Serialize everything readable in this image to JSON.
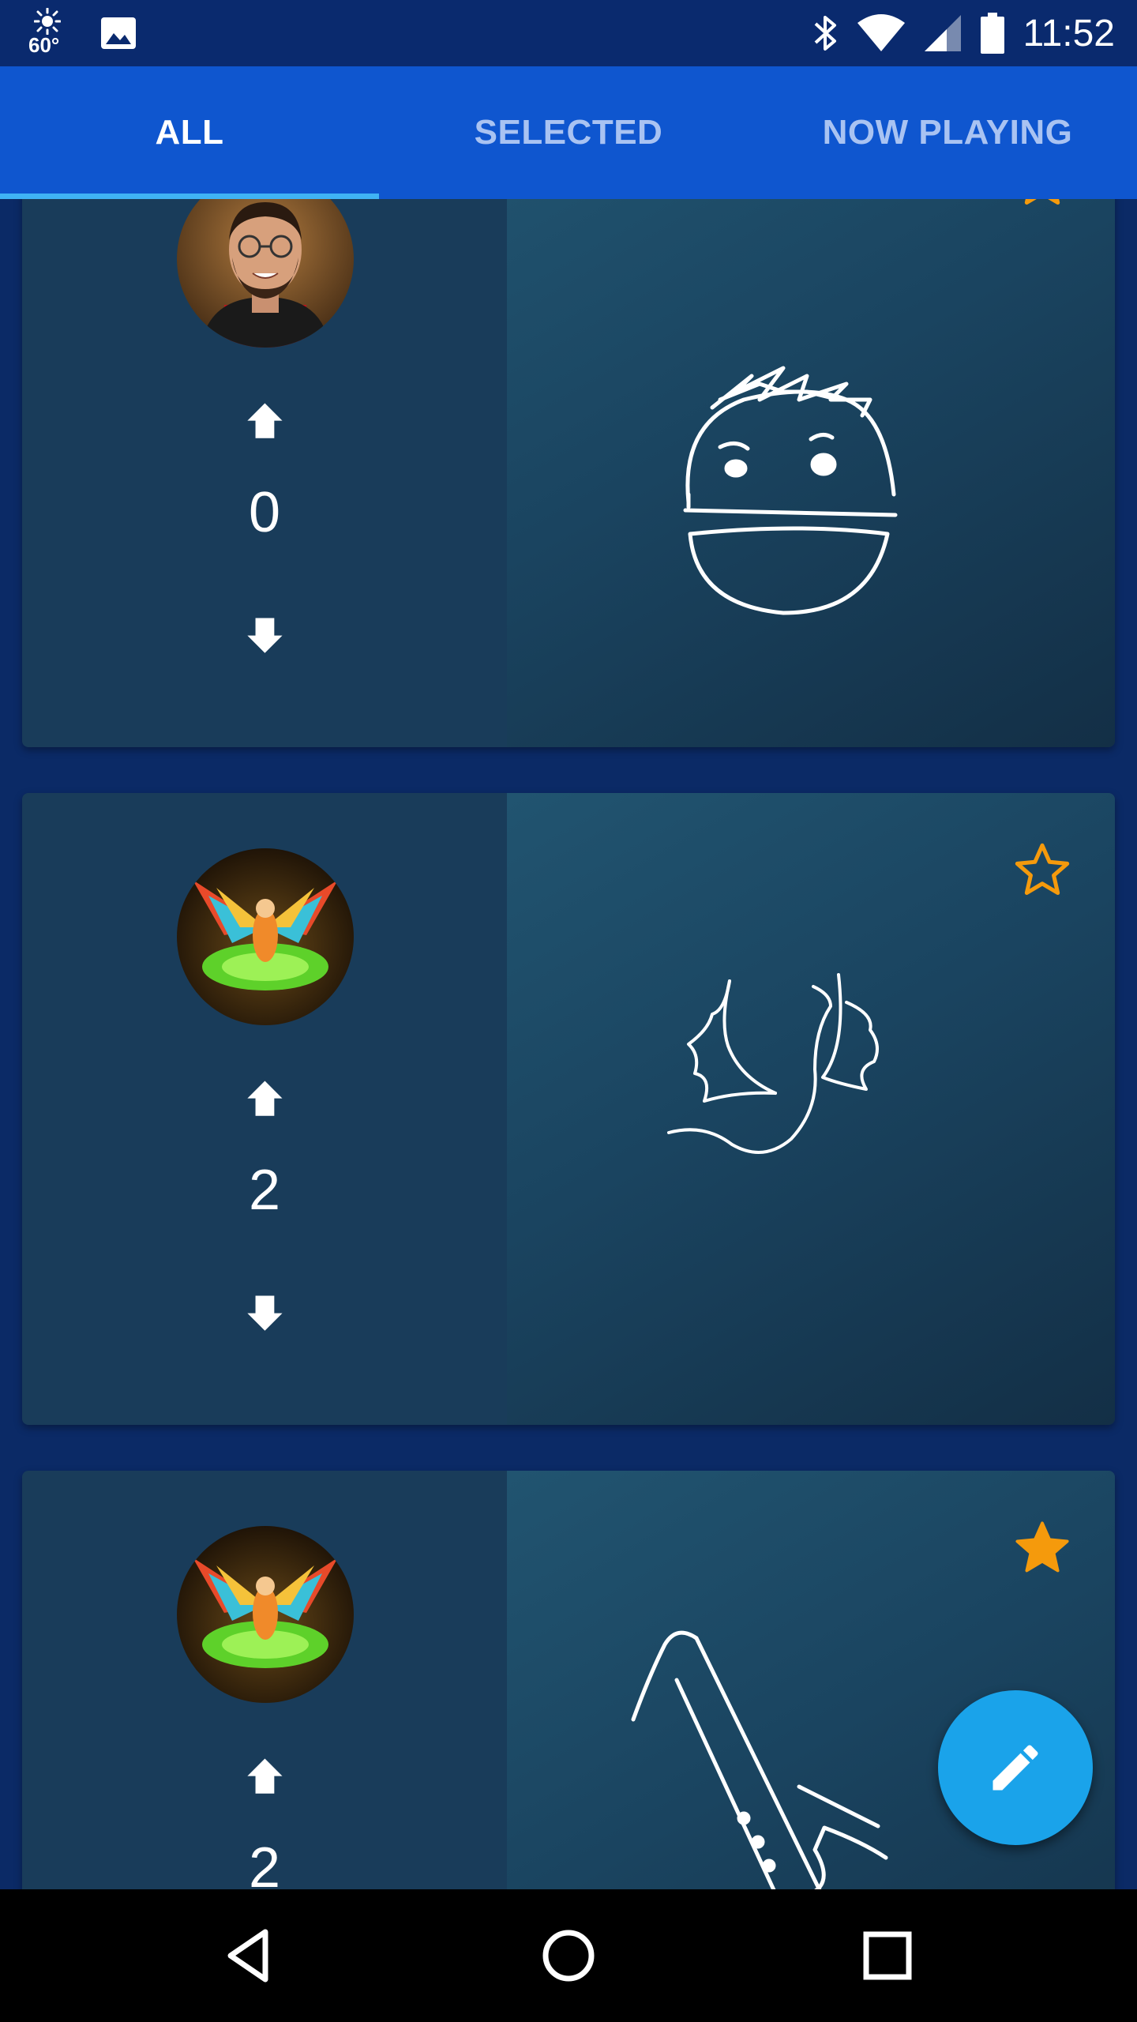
{
  "status_bar": {
    "temperature": "60°",
    "time": "11:52",
    "icons": [
      "weather-sun-icon",
      "image-notification-icon",
      "bluetooth-icon",
      "wifi-icon",
      "cell-signal-icon",
      "battery-icon"
    ]
  },
  "tabs": [
    {
      "label": "ALL",
      "active": true
    },
    {
      "label": "SELECTED",
      "active": false
    },
    {
      "label": "NOW PLAYING",
      "active": false
    }
  ],
  "cards": [
    {
      "avatar": "man-with-glasses-photo",
      "score": "0",
      "starred": false,
      "drawing": "face-doodle"
    },
    {
      "avatar": "dragon-creature-art",
      "score": "2",
      "starred": false,
      "drawing": "dragon-doodle"
    },
    {
      "avatar": "dragon-creature-art",
      "score": "2",
      "starred": true,
      "drawing": "saxophone-doodle"
    }
  ],
  "colors": {
    "status_bar": "#0a2a6e",
    "tab_bar": "#0f56cf",
    "tab_indicator": "#3fb3f5",
    "page_background": "#0b2a66",
    "card_left": "#193c5a",
    "card_right": "#1d4a66",
    "star": "#f59a0c",
    "fab": "#1aa3ea"
  },
  "fab": {
    "icon": "pencil-edit-icon"
  },
  "navigation": {
    "buttons": [
      "back-icon",
      "home-icon",
      "recents-icon"
    ]
  }
}
